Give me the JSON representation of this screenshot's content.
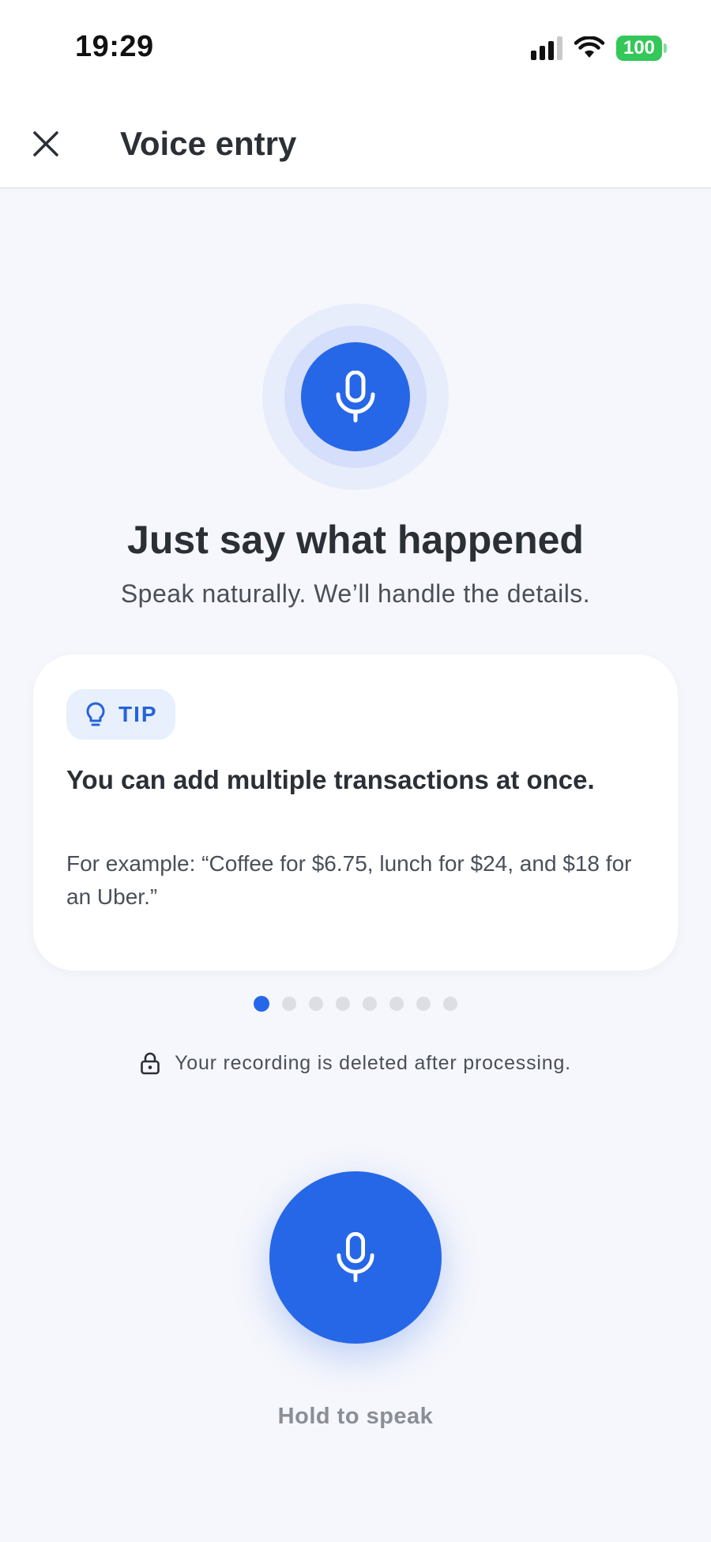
{
  "status_bar": {
    "time": "19:29",
    "battery": "100",
    "battery_color": "#34c759",
    "icons": [
      "signal-icon",
      "wifi-icon",
      "battery-icon"
    ]
  },
  "header": {
    "close_icon": "close-icon",
    "title": "Voice entry"
  },
  "hero": {
    "icon": "microphone-icon",
    "headline": "Just say what happened",
    "subhead": "Speak naturally. We’ll handle the details."
  },
  "tip_card": {
    "badge_icon": "lightbulb-icon",
    "badge_label": "TIP",
    "title": "You can add multiple transactions at once.",
    "body": "For example: “Coffee for $6.75, lunch for $24, and $18 for an Uber.”"
  },
  "pagination": {
    "total": 8,
    "current": 1
  },
  "privacy": {
    "icon": "lock-icon",
    "text": "Your recording is deleted after processing."
  },
  "speak": {
    "icon": "microphone-icon",
    "label": "Hold to speak"
  },
  "colors": {
    "accent": "#2667e8",
    "background": "#f6f7fc",
    "tip_badge_bg": "#e8effd"
  }
}
